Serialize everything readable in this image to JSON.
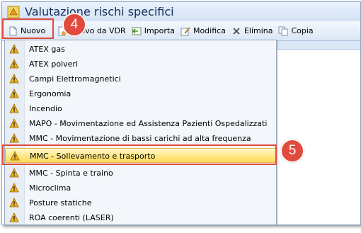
{
  "window": {
    "title": "Valutazione rischi specifici"
  },
  "toolbar": {
    "buttons": [
      {
        "label": "Nuovo",
        "icon": "new-document-icon"
      },
      {
        "label": "Nuovo da VDR",
        "icon": "new-from-vdr-icon"
      },
      {
        "label": "Importa",
        "icon": "import-icon"
      },
      {
        "label": "Modifica",
        "icon": "edit-icon"
      },
      {
        "label": "Elimina",
        "icon": "delete-icon"
      },
      {
        "label": "Copia",
        "icon": "copy-icon"
      }
    ]
  },
  "menu": {
    "items": [
      {
        "label": "ATEX gas"
      },
      {
        "label": "ATEX polveri"
      },
      {
        "label": "Campi Elettromagnetici"
      },
      {
        "label": "Ergonomia"
      },
      {
        "label": "Incendio"
      },
      {
        "label": "MAPO - Movimentazione ed Assistenza Pazienti Ospedalizzati"
      },
      {
        "label": "MMC - Movimentazione di bassi carichi ad alta frequenza"
      },
      {
        "label": "MMC - Sollevamento e trasporto",
        "selected": true
      },
      {
        "label": "MMC - Spinta e traino"
      },
      {
        "label": "Microclima"
      },
      {
        "label": "Posture statiche"
      },
      {
        "label": "ROA coerenti (LASER)"
      }
    ]
  },
  "callouts": {
    "step4": "4",
    "step5": "5"
  },
  "colors": {
    "callout": "#e14a3d",
    "warning": "#f2b21b",
    "selection": "#ffe98a",
    "title_text": "#15305b"
  }
}
